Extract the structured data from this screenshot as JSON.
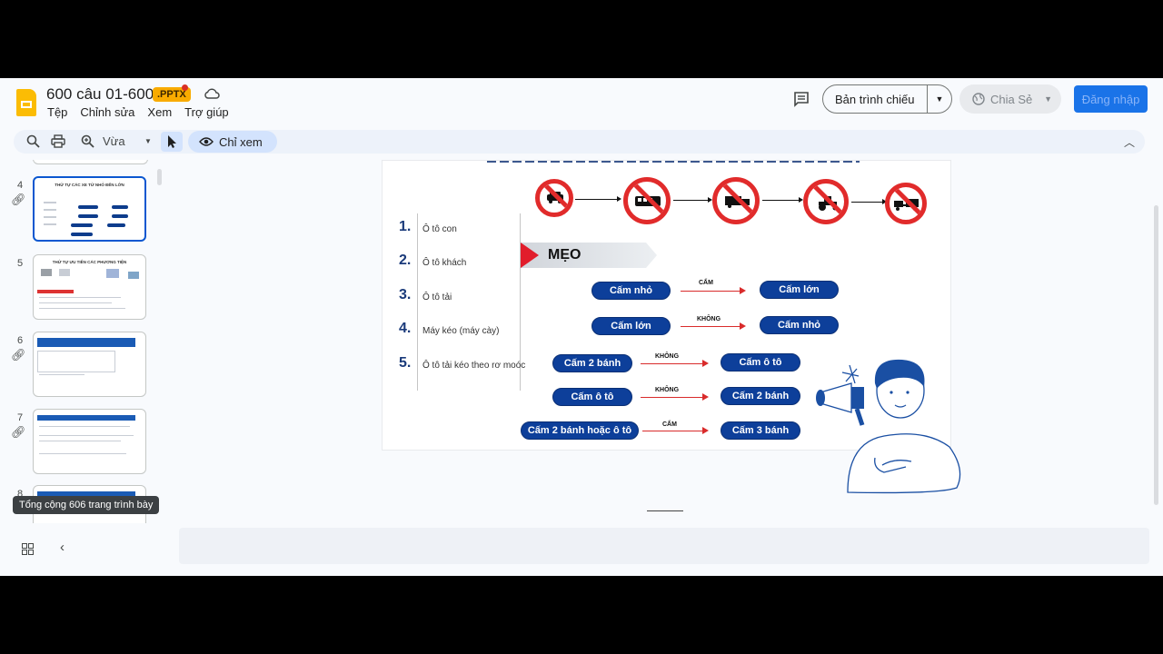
{
  "header": {
    "doc_title": "600 câu 01-600",
    "file_badge": ".PPTX",
    "menu": [
      "Tệp",
      "Chỉnh sửa",
      "Xem",
      "Trợ giúp"
    ],
    "present_label": "Bản trình chiếu",
    "share_label": "Chia Sẻ",
    "login_label": "Đăng nhập"
  },
  "toolbar": {
    "zoom_label": "Vừa",
    "view_mode_label": "Chỉ xem"
  },
  "filmstrip": {
    "slides": [
      {
        "num": "4",
        "title": "THỨ TỰ CÁC XE TỪ NHỎ ĐẾN LỚN"
      },
      {
        "num": "5",
        "title": "THỨ TỰ ƯU TIÊN CÁC PHƯƠNG TIỆN"
      },
      {
        "num": "6"
      },
      {
        "num": "7"
      },
      {
        "num": "8"
      }
    ],
    "tooltip": "Tổng cộng 606 trang trình bày"
  },
  "slide": {
    "list": [
      {
        "num": "1.",
        "text": "Ô tô con"
      },
      {
        "num": "2.",
        "text": "Ô tô khách"
      },
      {
        "num": "3.",
        "text": "Ô tô tải"
      },
      {
        "num": "4.",
        "text": "Máy kéo (máy cày)"
      },
      {
        "num": "5.",
        "text": "Ô tô tải kéo theo rơ moóc"
      }
    ],
    "meo": "MẸO",
    "rules": [
      {
        "left": "Cấm nhỏ",
        "verb": "CẤM",
        "right": "Cấm lớn"
      },
      {
        "left": "Cấm lớn",
        "verb": "KHÔNG",
        "right": "Cấm nhỏ"
      },
      {
        "left": "Cấm 2 bánh",
        "verb": "KHÔNG",
        "right": "Cấm ô tô"
      },
      {
        "left": "Cấm ô tô",
        "verb": "KHÔNG",
        "right": "Cấm 2 bánh"
      },
      {
        "left": "Cấm 2 bánh hoặc ô tô",
        "verb": "CẤM",
        "right": "Cấm 3 bánh"
      }
    ]
  },
  "colors": {
    "accent": "#0b57d0",
    "badge": "#f9ab00",
    "pill": "#0d3f9a",
    "sign_red": "#e12b2b"
  }
}
